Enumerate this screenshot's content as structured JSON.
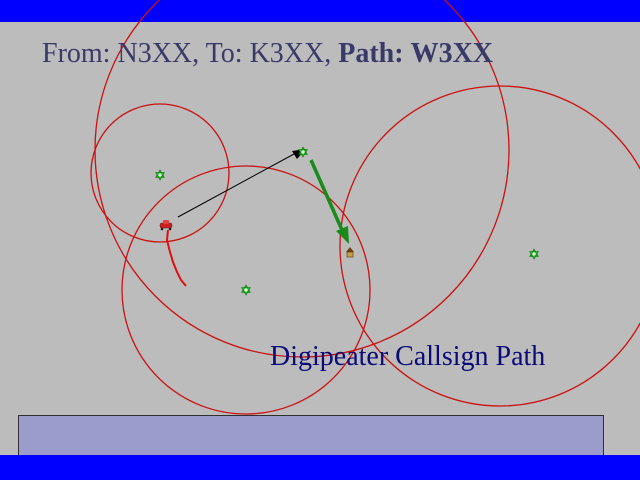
{
  "header": {
    "from_label": "From:",
    "from_call": "N3XX",
    "to_label": "To:",
    "to_call": "K3XX",
    "path_label": "Path:",
    "path_call": "W3XX"
  },
  "caption": "Digipeater Callsign Path",
  "colors": {
    "band": "#0000ff",
    "background": "#bcbcbc",
    "header_text": "#3a3a6a",
    "caption_text": "#0a0a78",
    "range_circle": "#cc1010",
    "trail": "#dd1010",
    "direct_arrow": "#000000",
    "digi_arrow": "#1a8a1a",
    "station_star": "#22bb22",
    "legend_fill": "#9a9ccc"
  },
  "icons": {
    "station": "star-of-david-icon",
    "sender": "car-icon",
    "receiver": "house-icon"
  }
}
